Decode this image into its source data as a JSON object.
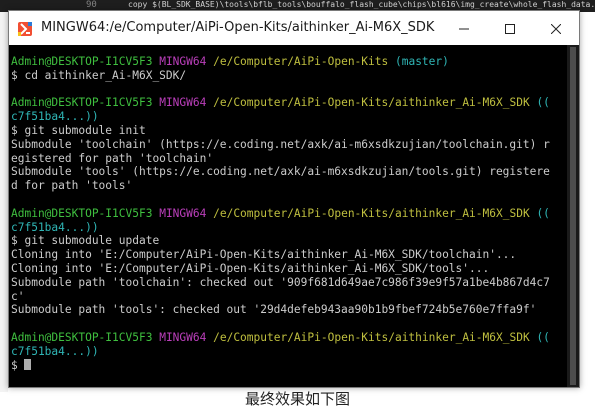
{
  "background_editor": {
    "line_number": "90",
    "code_fragment": "copy $(BL_SDK_BASE)\\tools\\bflb_tools\\bouffalo_flash_cube\\chips\\bl616\\img_create\\whole_flash_data.bin buil"
  },
  "window": {
    "title": "MINGW64:/e/Computer/AiPi-Open-Kits/aithinker_Ai-M6X_SDK",
    "icon": "mingw-git-icon",
    "controls": {
      "minimize": "—",
      "maximize": "☐",
      "close": "✕"
    }
  },
  "terminal": {
    "lines": [
      {
        "segs": [
          {
            "t": "Admin@DESKTOP-I1CV5F3",
            "c": "g"
          },
          {
            "t": " ",
            "c": "w"
          },
          {
            "t": "MINGW64",
            "c": "m"
          },
          {
            "t": " ",
            "c": "w"
          },
          {
            "t": "/e/Computer/AiPi-Open-Kits",
            "c": "y"
          },
          {
            "t": " ",
            "c": "w"
          },
          {
            "t": "(master)",
            "c": "c"
          }
        ]
      },
      {
        "segs": [
          {
            "t": "$ cd aithinker_Ai-M6X_SDK/",
            "c": "w"
          }
        ]
      },
      {
        "segs": [
          {
            "t": "",
            "c": "w"
          }
        ]
      },
      {
        "segs": [
          {
            "t": "Admin@DESKTOP-I1CV5F3",
            "c": "g"
          },
          {
            "t": " ",
            "c": "w"
          },
          {
            "t": "MINGW64",
            "c": "m"
          },
          {
            "t": " ",
            "c": "w"
          },
          {
            "t": "/e/Computer/AiPi-Open-Kits/aithinker_Ai-M6X_SDK",
            "c": "y"
          },
          {
            "t": " ",
            "c": "w"
          },
          {
            "t": "((",
            "c": "c"
          }
        ]
      },
      {
        "segs": [
          {
            "t": "c7f51ba4...))",
            "c": "c"
          }
        ]
      },
      {
        "segs": [
          {
            "t": "$ git submodule init",
            "c": "w"
          }
        ]
      },
      {
        "segs": [
          {
            "t": "Submodule 'toolchain' (https://e.coding.net/axk/ai-m6xsdkzujian/toolchain.git) r",
            "c": "w"
          }
        ]
      },
      {
        "segs": [
          {
            "t": "egistered for path 'toolchain'",
            "c": "w"
          }
        ]
      },
      {
        "segs": [
          {
            "t": "Submodule 'tools' (https://e.coding.net/axk/ai-m6xsdkzujian/tools.git) registere",
            "c": "w"
          }
        ]
      },
      {
        "segs": [
          {
            "t": "d for path 'tools'",
            "c": "w"
          }
        ]
      },
      {
        "segs": [
          {
            "t": "",
            "c": "w"
          }
        ]
      },
      {
        "segs": [
          {
            "t": "Admin@DESKTOP-I1CV5F3",
            "c": "g"
          },
          {
            "t": " ",
            "c": "w"
          },
          {
            "t": "MINGW64",
            "c": "m"
          },
          {
            "t": " ",
            "c": "w"
          },
          {
            "t": "/e/Computer/AiPi-Open-Kits/aithinker_Ai-M6X_SDK",
            "c": "y"
          },
          {
            "t": " ",
            "c": "w"
          },
          {
            "t": "((",
            "c": "c"
          }
        ]
      },
      {
        "segs": [
          {
            "t": "c7f51ba4...))",
            "c": "c"
          }
        ]
      },
      {
        "segs": [
          {
            "t": "$ git submodule update",
            "c": "w"
          }
        ]
      },
      {
        "segs": [
          {
            "t": "Cloning into 'E:/Computer/AiPi-Open-Kits/aithinker_Ai-M6X_SDK/toolchain'...",
            "c": "w"
          }
        ]
      },
      {
        "segs": [
          {
            "t": "Cloning into 'E:/Computer/AiPi-Open-Kits/aithinker_Ai-M6X_SDK/tools'...",
            "c": "w"
          }
        ]
      },
      {
        "segs": [
          {
            "t": "Submodule path 'toolchain': checked out '909f681d649ae7c986f39e9f57a1be4b867d4c7",
            "c": "w"
          }
        ]
      },
      {
        "segs": [
          {
            "t": "c'",
            "c": "w"
          }
        ]
      },
      {
        "segs": [
          {
            "t": "Submodule path 'tools': checked out '29d4defeb943aa90b1b9fbef724b5e760e7ffa9f'",
            "c": "w"
          }
        ]
      },
      {
        "segs": [
          {
            "t": "",
            "c": "w"
          }
        ]
      },
      {
        "segs": [
          {
            "t": "Admin@DESKTOP-I1CV5F3",
            "c": "g"
          },
          {
            "t": " ",
            "c": "w"
          },
          {
            "t": "MINGW64",
            "c": "m"
          },
          {
            "t": " ",
            "c": "w"
          },
          {
            "t": "/e/Computer/AiPi-Open-Kits/aithinker_Ai-M6X_SDK",
            "c": "y"
          },
          {
            "t": " ",
            "c": "w"
          },
          {
            "t": "((",
            "c": "c"
          }
        ]
      },
      {
        "segs": [
          {
            "t": "c7f51ba4...))",
            "c": "c"
          }
        ]
      },
      {
        "segs": [
          {
            "t": "$ ",
            "c": "w"
          }
        ],
        "cursor": true
      }
    ]
  },
  "colors": {
    "user_host": "#3fbf3f",
    "mingw": "#bb3fbb",
    "path": "#bfbf3f",
    "branch": "#2fb5b5",
    "text": "#cccccc",
    "terminal_bg": "#000000"
  },
  "caption": "最终效果如下图"
}
